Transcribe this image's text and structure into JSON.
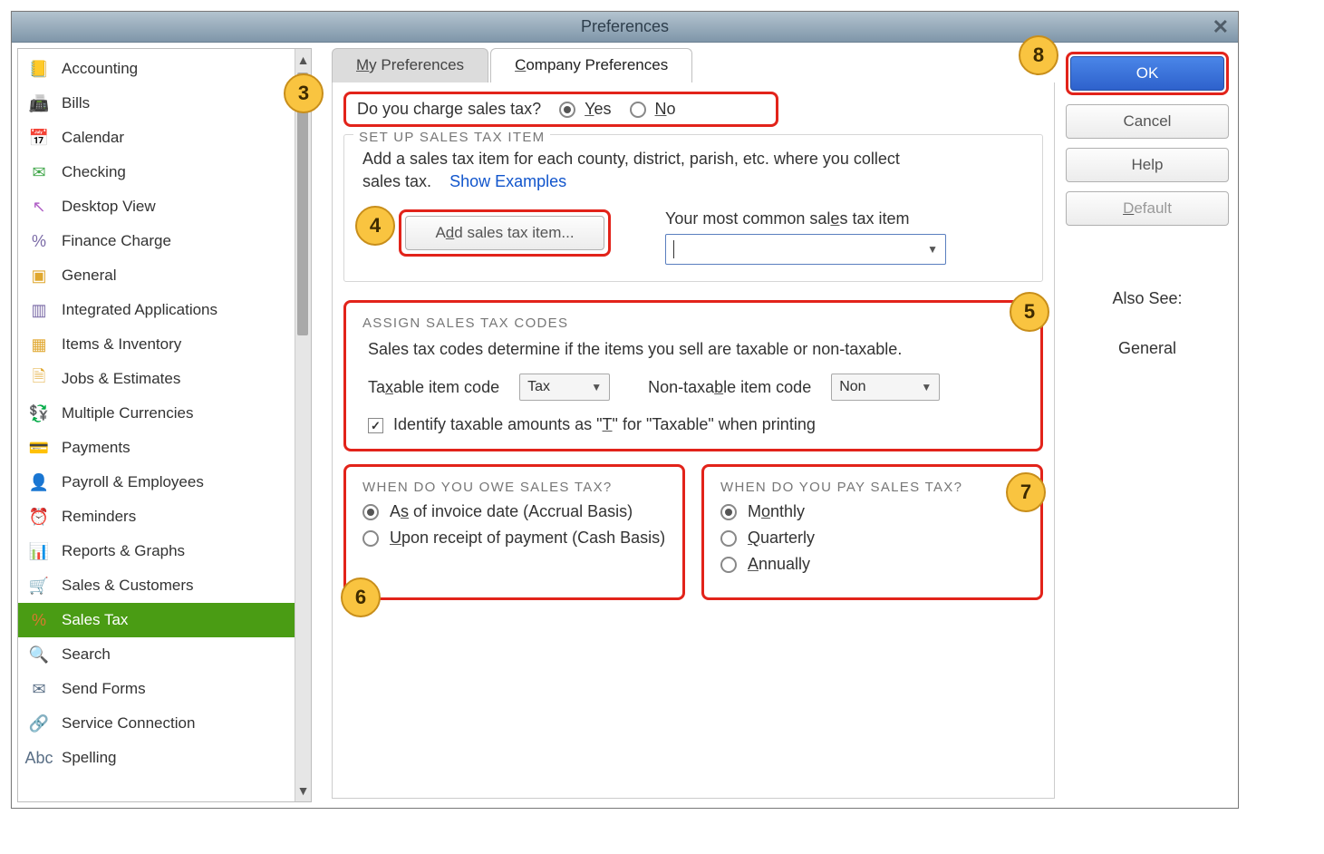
{
  "window": {
    "title": "Preferences"
  },
  "tabs": {
    "my": "My Preferences",
    "company": "Company Preferences"
  },
  "sidebar": {
    "items": [
      {
        "label": "Accounting",
        "icon": "📒",
        "color": "#e0a72e"
      },
      {
        "label": "Bills",
        "icon": "📠",
        "color": "#5a6f86"
      },
      {
        "label": "Calendar",
        "icon": "📅",
        "color": "#6a7a8a"
      },
      {
        "label": "Checking",
        "icon": "✉",
        "color": "#3fa648"
      },
      {
        "label": "Desktop View",
        "icon": "↖",
        "color": "#b263c7"
      },
      {
        "label": "Finance Charge",
        "icon": "%",
        "color": "#7a6aa6"
      },
      {
        "label": "General",
        "icon": "▣",
        "color": "#e0a72e"
      },
      {
        "label": "Integrated Applications",
        "icon": "▥",
        "color": "#7a6aa6"
      },
      {
        "label": "Items & Inventory",
        "icon": "▦",
        "color": "#e0a72e"
      },
      {
        "label": "Jobs & Estimates",
        "icon": "🗎",
        "color": "#e0a72e"
      },
      {
        "label": "Multiple Currencies",
        "icon": "💱",
        "color": "#3fa648"
      },
      {
        "label": "Payments",
        "icon": "💳",
        "color": "#3fa648"
      },
      {
        "label": "Payroll & Employees",
        "icon": "👤",
        "color": "#3fa648"
      },
      {
        "label": "Reminders",
        "icon": "⏰",
        "color": "#e0a72e"
      },
      {
        "label": "Reports & Graphs",
        "icon": "📊",
        "color": "#3fa648"
      },
      {
        "label": "Sales & Customers",
        "icon": "🛒",
        "color": "#d67a2e"
      },
      {
        "label": "Sales Tax",
        "icon": "%",
        "color": "#d67a2e",
        "selected": true
      },
      {
        "label": "Search",
        "icon": "🔍",
        "color": "#7a6f86"
      },
      {
        "label": "Send Forms",
        "icon": "✉",
        "color": "#5a6f86"
      },
      {
        "label": "Service Connection",
        "icon": "🔗",
        "color": "#7a6f86"
      },
      {
        "label": "Spelling",
        "icon": "Abc",
        "color": "#5a6f86"
      }
    ]
  },
  "charge": {
    "question": "Do you charge sales tax?",
    "yes": "Yes",
    "no": "No",
    "value": "yes"
  },
  "setup": {
    "title": "SET UP SALES TAX ITEM",
    "desc": "Add a sales tax item for each county, district, parish, etc. where you collect sales tax.",
    "examplesLink": "Show Examples",
    "addBtn": "Add sales tax item...",
    "commonLabel": "Your most common sales tax item",
    "commonValue": ""
  },
  "assign": {
    "title": "ASSIGN SALES TAX CODES",
    "desc": "Sales tax codes determine if the items you sell are taxable or non-taxable.",
    "taxableLabel": "Taxable item code",
    "taxableValue": "Tax",
    "nonTaxLabel": "Non-taxable item code",
    "nonTaxValue": "Non",
    "checkLabel": "Identify taxable amounts as \"T\" for \"Taxable\" when printing",
    "checked": true
  },
  "owe": {
    "title": "WHEN DO YOU OWE SALES TAX?",
    "opt1": "As of invoice date (Accrual Basis)",
    "opt2": "Upon receipt of payment (Cash Basis)",
    "value": "accrual"
  },
  "pay": {
    "title": "WHEN DO YOU PAY SALES TAX?",
    "opt1": "Monthly",
    "opt2": "Quarterly",
    "opt3": "Annually",
    "value": "monthly"
  },
  "buttons": {
    "ok": "OK",
    "cancel": "Cancel",
    "help": "Help",
    "default": "Default"
  },
  "alsoSee": {
    "heading": "Also See:",
    "link": "General"
  },
  "callouts": {
    "c3": "3",
    "c4": "4",
    "c5": "5",
    "c6": "6",
    "c7": "7",
    "c8": "8"
  }
}
